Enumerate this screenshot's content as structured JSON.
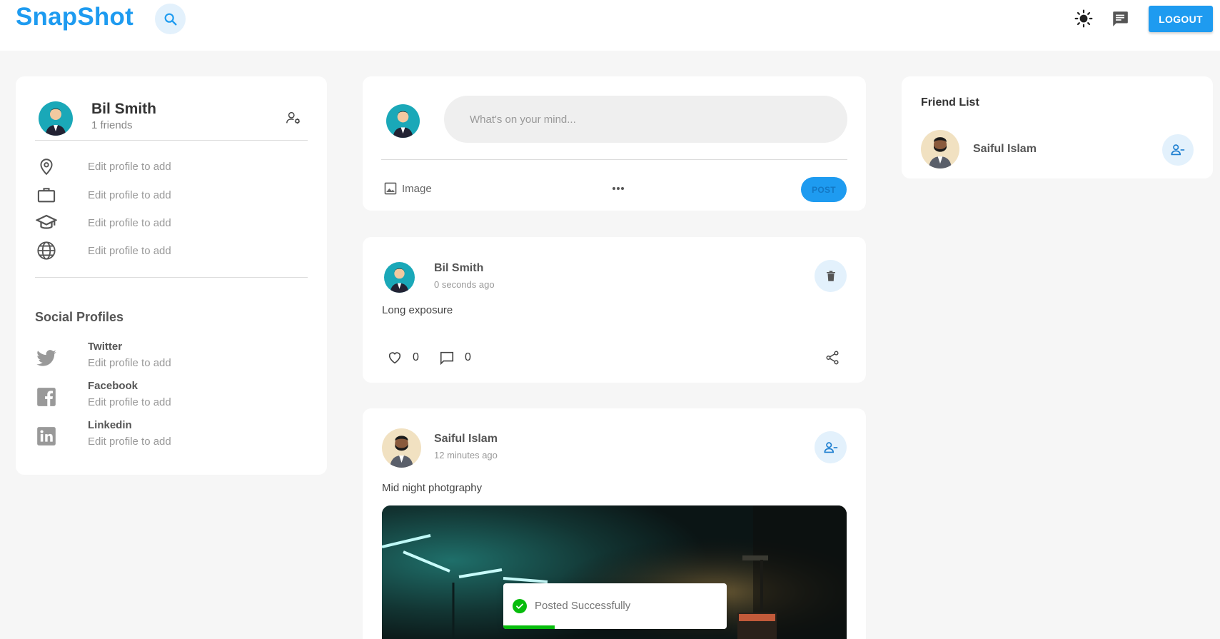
{
  "header": {
    "brand": "SnapShot",
    "logout_label": "LOGOUT"
  },
  "profile": {
    "name": "Bil Smith",
    "friends": "1 friends",
    "info": [
      {
        "icon": "location-pin-icon",
        "text": "Edit profile to add"
      },
      {
        "icon": "briefcase-icon",
        "text": "Edit profile to add"
      },
      {
        "icon": "graduation-cap-icon",
        "text": "Edit profile to add"
      },
      {
        "icon": "globe-icon",
        "text": "Edit profile to add"
      }
    ],
    "social_title": "Social Profiles",
    "social": [
      {
        "icon": "twitter-icon",
        "name": "Twitter",
        "value": "Edit profile to add"
      },
      {
        "icon": "facebook-icon",
        "name": "Facebook",
        "value": "Edit profile to add"
      },
      {
        "icon": "linkedin-icon",
        "name": "Linkedin",
        "value": "Edit profile to add"
      }
    ]
  },
  "composer": {
    "placeholder": "What's on your mind...",
    "image_label": "Image",
    "post_label": "POST"
  },
  "posts": [
    {
      "author": "Bil Smith",
      "time": "0 seconds ago",
      "text": "Long exposure",
      "likes": "0",
      "comments": "0"
    },
    {
      "author": "Saiful Islam",
      "time": "12 minutes ago",
      "text": "Mid night photgraphy"
    }
  ],
  "friend_list": {
    "title": "Friend List",
    "friends": [
      {
        "name": "Saiful Islam"
      }
    ]
  },
  "toast": {
    "message": "Posted Successfully",
    "progress": 0.23
  },
  "colors": {
    "accent": "#1e9bf0",
    "success": "#07bc0c",
    "background": "#f6f6f6"
  }
}
